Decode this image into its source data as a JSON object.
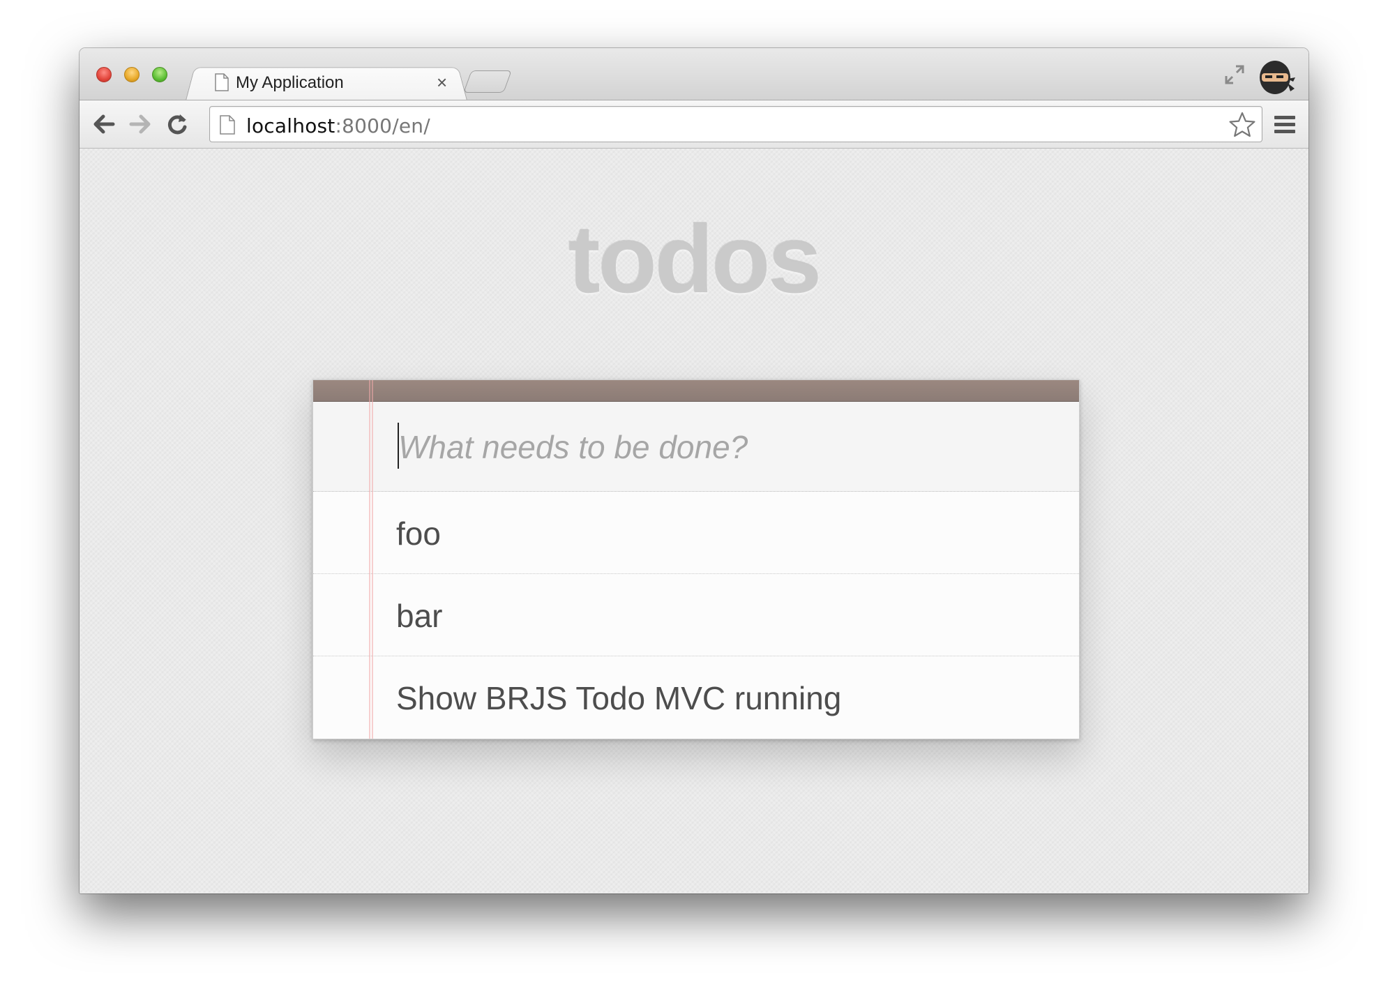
{
  "browser": {
    "tab": {
      "title": "My Application",
      "close_symbol": "×"
    },
    "address_bar": {
      "host": "localhost",
      "path": ":8000/en/"
    },
    "icons": {
      "back": "back-arrow-icon",
      "forward": "forward-arrow-icon",
      "reload": "reload-icon",
      "bookmark": "star-icon",
      "menu": "hamburger-menu-icon",
      "fullscreen": "fullscreen-icon",
      "profile": "ninja-avatar-icon"
    }
  },
  "app": {
    "title": "todos",
    "new_todo": {
      "placeholder": "What needs to be done?",
      "value": ""
    },
    "todos": [
      {
        "label": "foo"
      },
      {
        "label": "bar"
      },
      {
        "label": "Show BRJS Todo MVC running"
      }
    ]
  },
  "colors": {
    "header_bar": "#8f7d77",
    "page_background": "#eaeaea",
    "placeholder": "#a6a6a6",
    "todo_text": "#4d4d4d"
  }
}
